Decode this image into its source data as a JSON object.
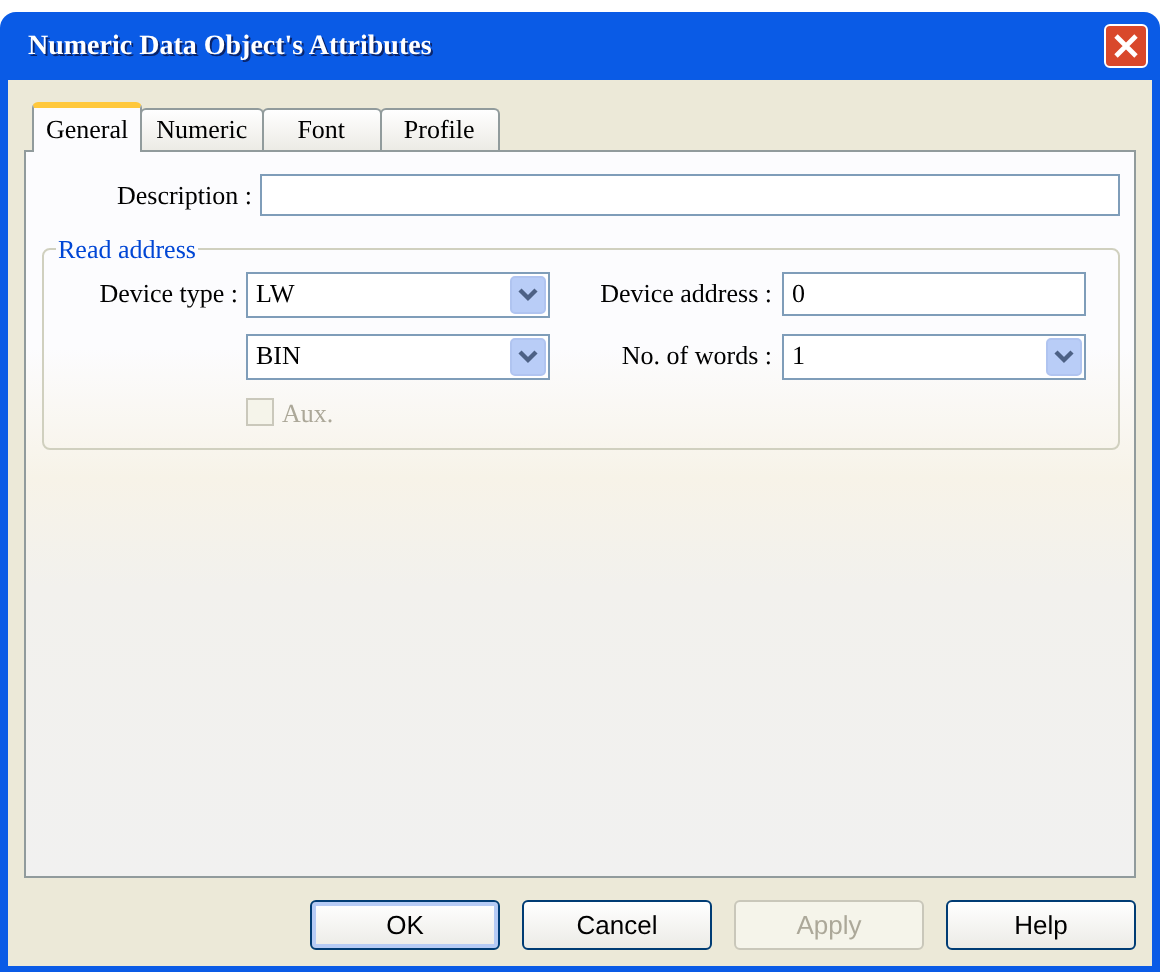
{
  "window": {
    "title": "Numeric Data Object's Attributes"
  },
  "tabs": [
    {
      "label": "General",
      "selected": true
    },
    {
      "label": "Numeric",
      "selected": false
    },
    {
      "label": "Font",
      "selected": false
    },
    {
      "label": "Profile",
      "selected": false
    }
  ],
  "description": {
    "label": "Description :"
  },
  "read_address": {
    "title": "Read address",
    "device_type": {
      "label": "Device type :",
      "value": "LW"
    },
    "format": {
      "value": "BIN"
    },
    "device_address": {
      "label": "Device address :",
      "value": "0"
    },
    "words": {
      "label": "No. of words :",
      "value": "1"
    },
    "aux": {
      "label": "Aux.",
      "checked": false,
      "disabled": true
    }
  },
  "buttons": [
    {
      "label": "OK",
      "disabled": false,
      "default": true
    },
    {
      "label": "Cancel",
      "disabled": false,
      "default": false
    },
    {
      "label": "Apply",
      "disabled": true,
      "default": false
    },
    {
      "label": "Help",
      "disabled": false,
      "default": false
    }
  ]
}
